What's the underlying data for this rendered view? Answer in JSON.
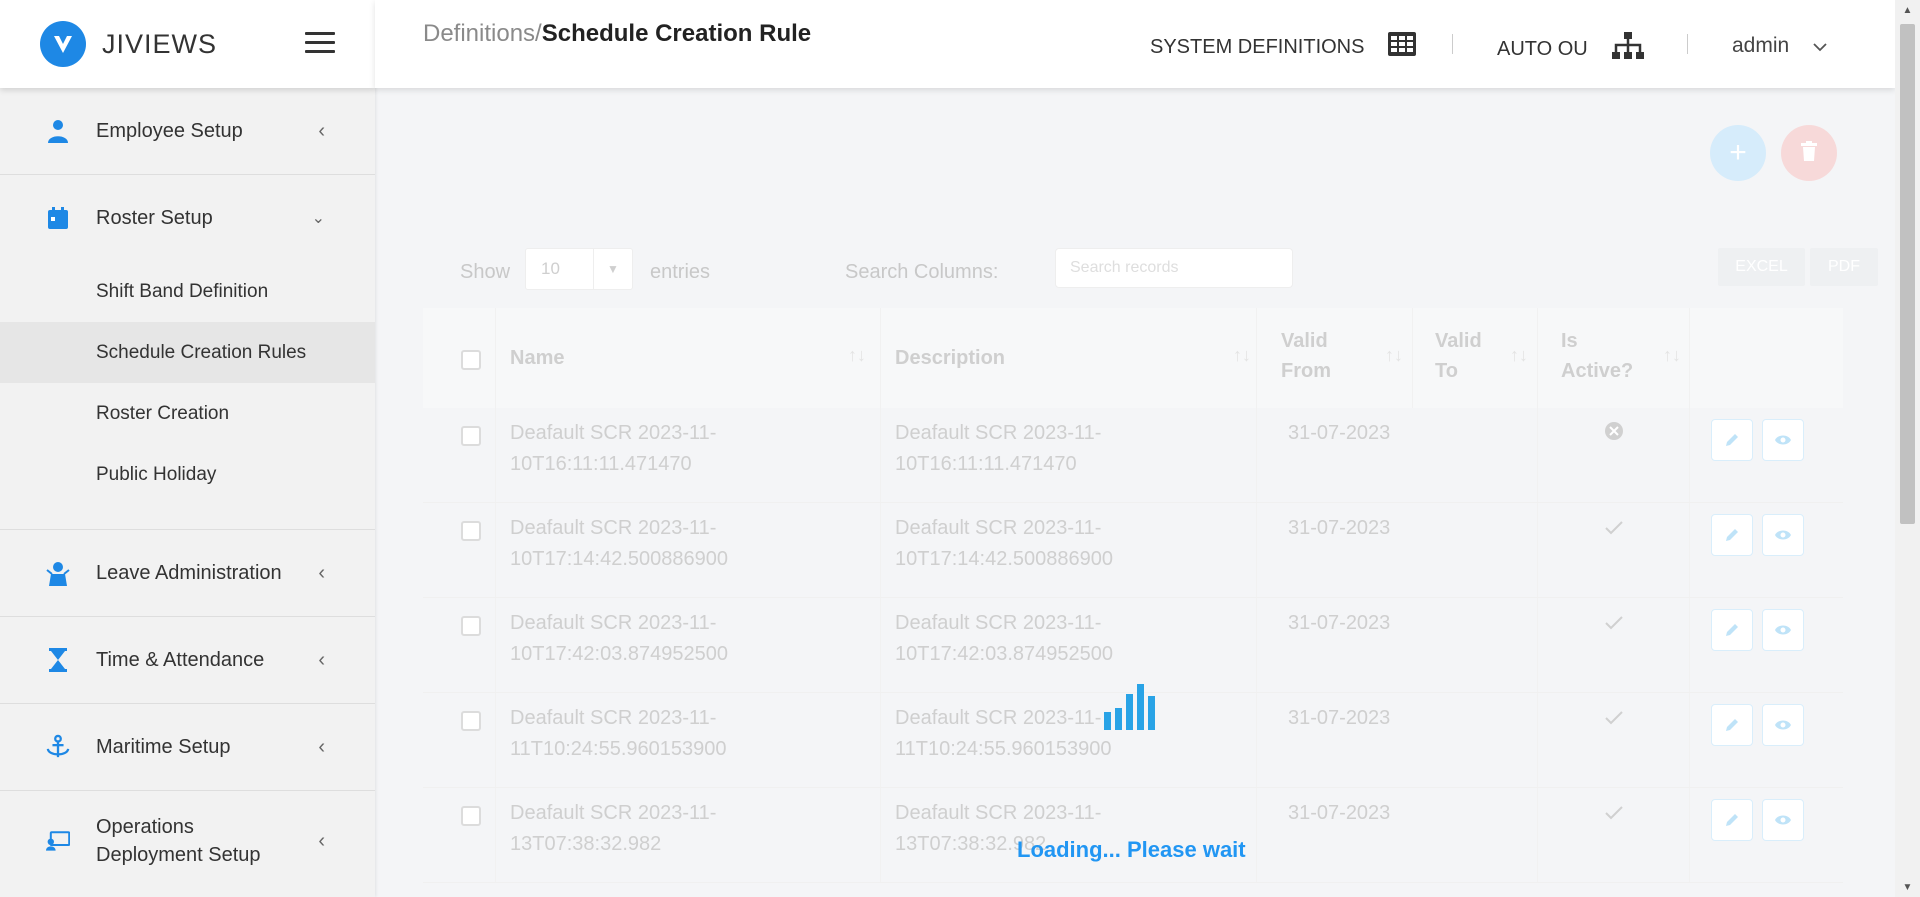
{
  "app": {
    "brand": "JIVIEWS"
  },
  "sidebar": {
    "groups": [
      {
        "label": "Employee Setup",
        "icon": "person-icon"
      },
      {
        "label": "Roster Setup",
        "icon": "calendar-icon",
        "items": [
          "Shift Band Definition",
          "Schedule Creation Rules",
          "Roster Creation",
          "Public Holiday"
        ],
        "active_item": "Schedule Creation Rules"
      },
      {
        "label": "Leave Administration",
        "icon": "leave-icon"
      },
      {
        "label": "Time & Attendance",
        "icon": "hourglass-icon"
      },
      {
        "label": "Maritime Setup",
        "icon": "anchor-icon"
      },
      {
        "label": "Operations Deployment Setup",
        "icon": "deployment-icon"
      }
    ]
  },
  "header": {
    "breadcrumb_parent": "Definitions/",
    "breadcrumb_current": "Schedule Creation Rule",
    "system_definitions": "SYSTEM DEFINITIONS",
    "auto_ou": "AUTO OU",
    "user": "admin"
  },
  "controls": {
    "show_label": "Show",
    "page_length": "10",
    "entries_label": "entries",
    "search_label": "Search Columns:",
    "search_placeholder": "Search records",
    "excel": "EXCEL",
    "pdf": "PDF"
  },
  "table": {
    "columns": [
      "Name",
      "Description",
      "Valid From",
      "Valid To",
      "Is Active?"
    ],
    "rows": [
      {
        "name": "Deafault SCR 2023-11-10T16:11:11.471470",
        "description": "Deafault SCR 2023-11-10T16:11:11.471470",
        "valid_from": "31-07-2023",
        "valid_to": "",
        "active": "no"
      },
      {
        "name": "Deafault SCR 2023-11-10T17:14:42.500886900",
        "description": "Deafault SCR 2023-11-10T17:14:42.500886900",
        "valid_from": "31-07-2023",
        "valid_to": "",
        "active": "yes"
      },
      {
        "name": "Deafault SCR 2023-11-10T17:42:03.874952500",
        "description": "Deafault SCR 2023-11-10T17:42:03.874952500",
        "valid_from": "31-07-2023",
        "valid_to": "",
        "active": "yes"
      },
      {
        "name": "Deafault SCR 2023-11-11T10:24:55.960153900",
        "description": "Deafault SCR 2023-11-11T10:24:55.960153900",
        "valid_from": "31-07-2023",
        "valid_to": "",
        "active": "yes"
      },
      {
        "name": "Deafault SCR 2023-11-13T07:38:32.982",
        "description": "Deafault SCR 2023-11-13T07:38:32.982",
        "valid_from": "31-07-2023",
        "valid_to": "",
        "active": "yes"
      }
    ]
  },
  "loading": {
    "text": "Loading... Please wait"
  },
  "colors": {
    "accent": "#1e88e5",
    "loader": "#29a3e6",
    "loading_text": "#2196f3"
  }
}
